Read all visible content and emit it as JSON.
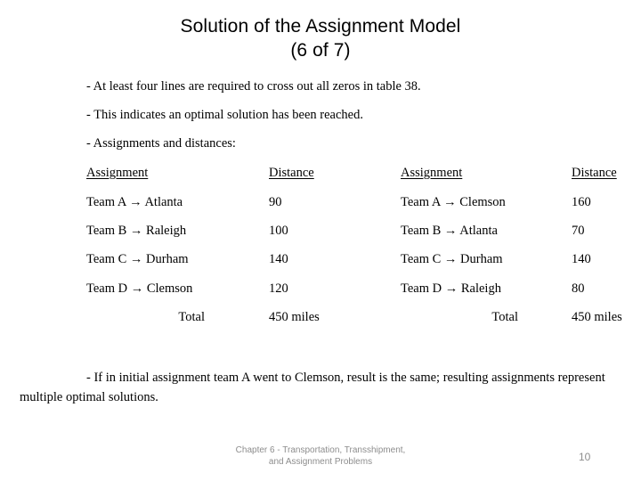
{
  "slide": {
    "title_line1": "Solution of the Assignment Model",
    "title_line2": "(6 of 7)",
    "bullets": [
      "- At least four lines are required to cross out all zeros in table 38.",
      "- This indicates an optimal solution has been reached.",
      "- Assignments and distances:"
    ],
    "table": {
      "headers": {
        "assignment_left": "Assignment",
        "distance_left": "Distance",
        "assignment_right": "Assignment",
        "distance_right": "Distance"
      },
      "rows": [
        {
          "assignment_left": "Team A → Atlanta",
          "distance_left": "90",
          "assignment_right": "Team A → Clemson",
          "distance_right": "160"
        },
        {
          "assignment_left": "Team B → Raleigh",
          "distance_left": "100",
          "assignment_right": "Team B → Atlanta",
          "distance_right": "70"
        },
        {
          "assignment_left": "Team C → Durham",
          "distance_left": "140",
          "assignment_right": "Team C → Durham",
          "distance_right": "140"
        },
        {
          "assignment_left": "Team D → Clemson",
          "distance_left": "120",
          "assignment_right": "Team D → Raleigh",
          "distance_right": "80"
        }
      ],
      "total": {
        "label_left": "Total",
        "value_left": "450 miles",
        "label_right": "Total",
        "value_right": "450 miles"
      }
    },
    "closing": "- If in initial assignment team A went to Clemson, result is the same; resulting assignments represent multiple optimal solutions.",
    "footer": {
      "line1": "Chapter 6 - Transportation, Transshipment,",
      "line2": "and Assignment Problems",
      "page_number": "10"
    },
    "colors": {
      "background": "#ffffff",
      "text": "#000000",
      "footer_text": "#8d8d8d"
    }
  }
}
